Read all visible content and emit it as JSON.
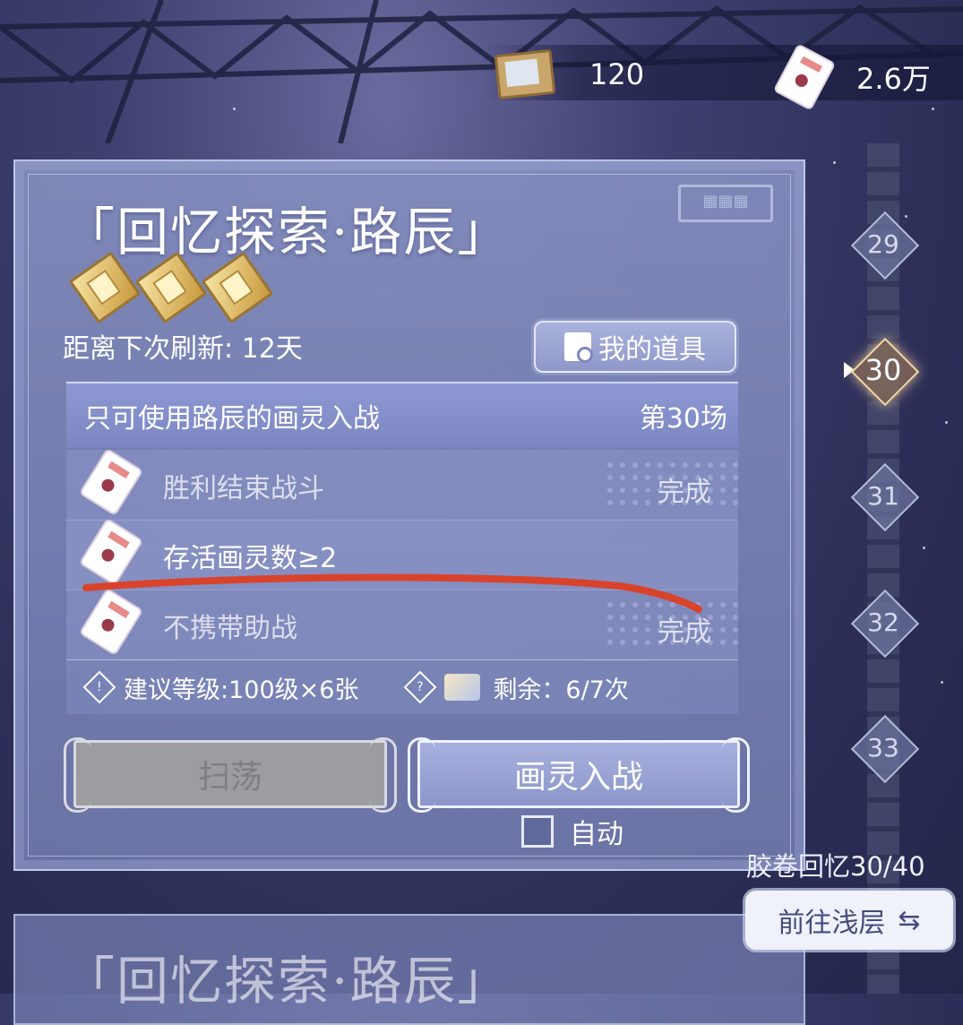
{
  "currencies": [
    {
      "icon": "film-card-icon",
      "value": "120"
    },
    {
      "icon": "ticket-icon",
      "value": "2.6万"
    }
  ],
  "panel": {
    "title": "「回忆探索·路辰」",
    "refresh_text": "距离下次刷新: 12天",
    "items_button": "我的道具",
    "restriction": "只可使用路辰的画灵入战",
    "stage": "第30场",
    "objectives": [
      {
        "text": "胜利结束战斗",
        "status": "完成",
        "done": true
      },
      {
        "text": "存活画灵数≥2",
        "status": "",
        "done": false
      },
      {
        "text": "不携带助战",
        "status": "完成",
        "done": true
      }
    ],
    "recommended": "建议等级:100级×6张",
    "remaining": "剩余：6/7次",
    "sweep_button": "扫荡",
    "battle_button": "画灵入战",
    "auto_label": "自动"
  },
  "timeline": {
    "nodes": [
      "29",
      "30",
      "31",
      "32",
      "33"
    ],
    "active": "30"
  },
  "progress_text": "胶卷回忆30/40",
  "goto_button": "前往浅层",
  "next_panel_title": "「回忆探索·路辰」",
  "colors": {
    "accent_line": "#d9432c",
    "panel": "#8a93c8"
  }
}
